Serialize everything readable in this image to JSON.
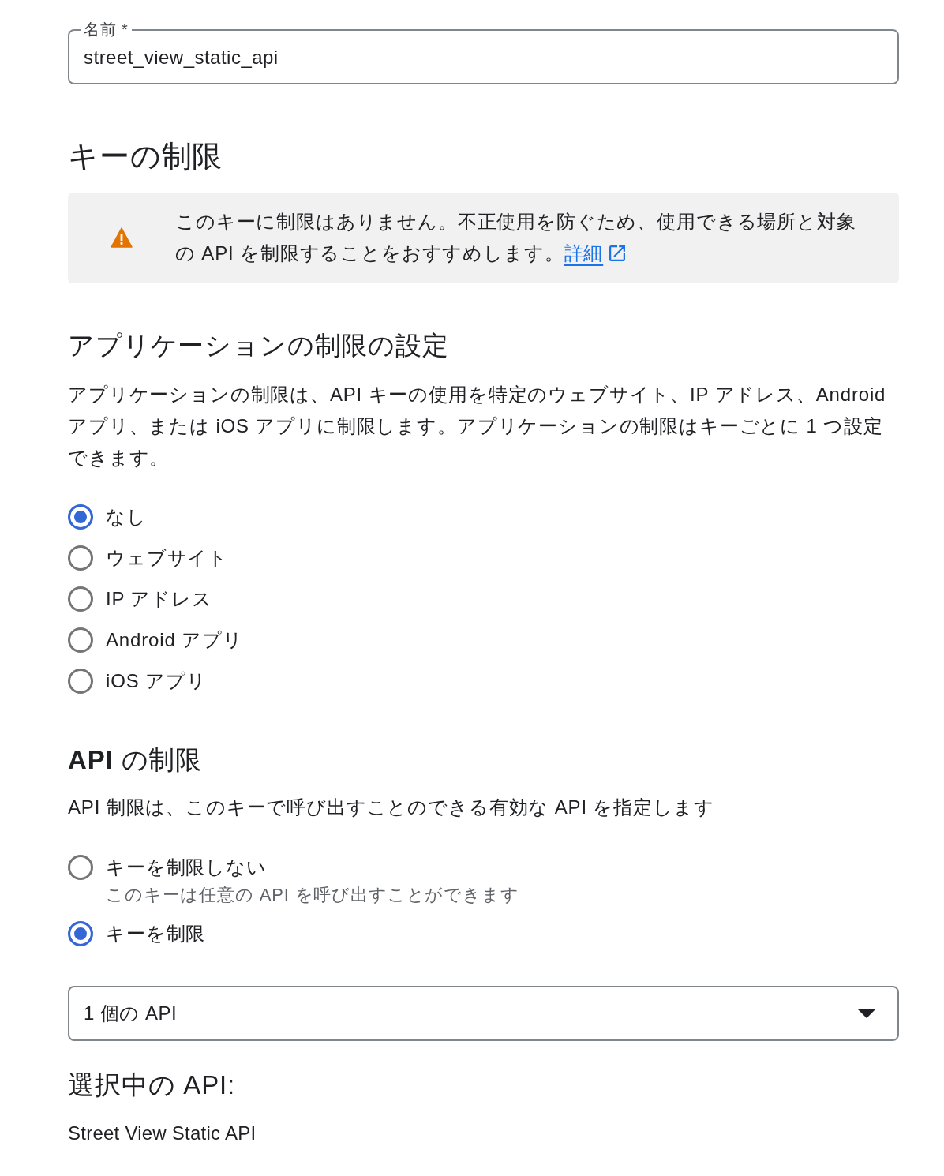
{
  "name_field": {
    "label": "名前 *",
    "value": "street_view_static_api"
  },
  "key_restrictions": {
    "heading": "キーの制限",
    "notice": {
      "text": "このキーに制限はありません。不正使用を防ぐため、使用できる場所と対象の API を制限することをおすすめします。",
      "link": "詳細"
    }
  },
  "application_restrictions": {
    "heading": "アプリケーションの制限の設定",
    "description": "アプリケーションの制限は、API キーの使用を特定のウェブサイト、IP アドレス、Android アプリ、または iOS アプリに制限します。アプリケーションの制限はキーごとに 1 つ設定できます。",
    "options": [
      {
        "label": "なし",
        "selected": true
      },
      {
        "label": "ウェブサイト",
        "selected": false
      },
      {
        "label": "IP アドレス",
        "selected": false
      },
      {
        "label": "Android アプリ",
        "selected": false
      },
      {
        "label": "iOS アプリ",
        "selected": false
      }
    ]
  },
  "api_restrictions": {
    "heading": "**API** の制限",
    "description": "API 制限は、このキーで呼び出すことのできる有効な API を指定します",
    "options": [
      {
        "label": "キーを制限しない",
        "hint": "このキーは任意の API を呼び出すことができます",
        "selected": false
      },
      {
        "label": "キーを制限",
        "selected": true
      }
    ],
    "dropdown": {
      "value": "1 個の API"
    },
    "selected_heading": "選択中の API:",
    "selected_apis": [
      "Street View Static API"
    ]
  }
}
